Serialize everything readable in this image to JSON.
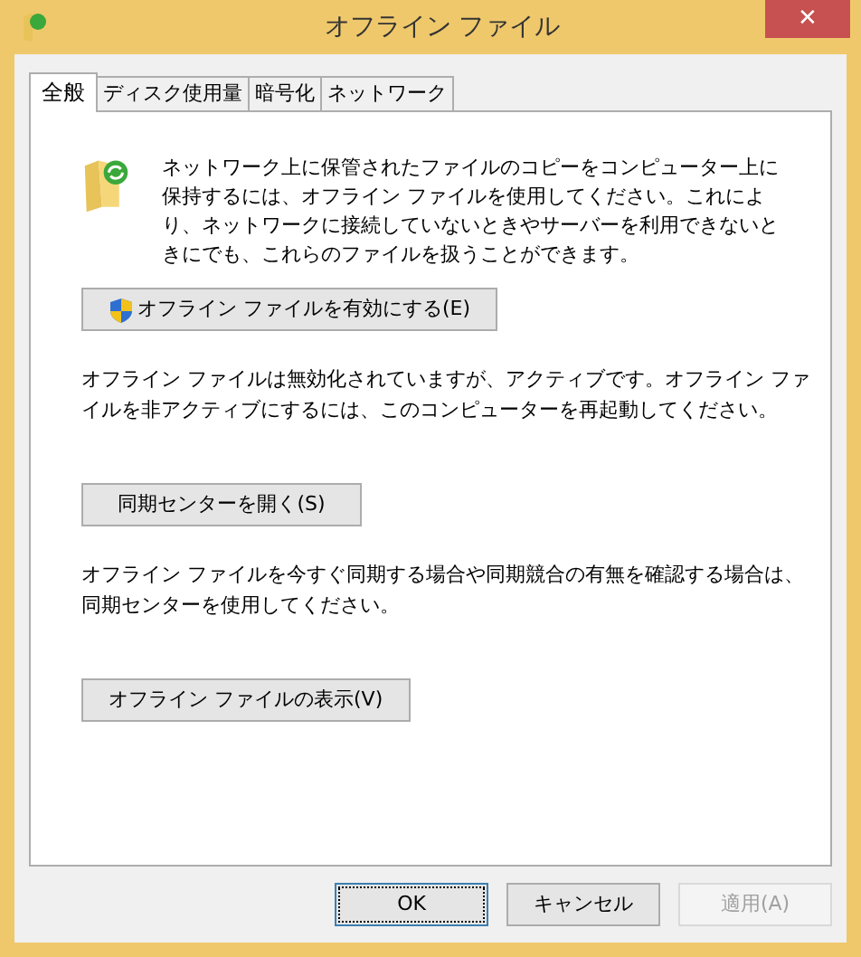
{
  "window": {
    "title": "オフライン ファイル",
    "close": "✕"
  },
  "tabs": [
    {
      "label": "全般",
      "selected": true
    },
    {
      "label": "ディスク使用量",
      "selected": false
    },
    {
      "label": "暗号化",
      "selected": false
    },
    {
      "label": "ネットワーク",
      "selected": false
    }
  ],
  "intro": "ネットワーク上に保管されたファイルのコピーをコンピューター上に保持するには、オフライン ファイルを使用してください。これにより、ネットワークに接続していないときやサーバーを利用できないときにでも、これらのファイルを扱うことができます。",
  "sections": [
    {
      "button": "オフライン ファイルを有効にする(E)",
      "shield": true,
      "text": "オフライン ファイルは無効化されていますが、アクティブです。オフライン ファイルを非アクティブにするには、このコンピューターを再起動してください。"
    },
    {
      "button": "同期センターを開く(S)",
      "shield": false,
      "text": "オフライン ファイルを今すぐ同期する場合や同期競合の有無を確認する場合は、同期センターを使用してください。"
    },
    {
      "button": "オフライン ファイルの表示(V)",
      "shield": false
    }
  ],
  "buttons": [
    {
      "label": "OK",
      "default": true,
      "disabled": false
    },
    {
      "label": "キャンセル",
      "default": false,
      "disabled": false
    },
    {
      "label": "適用(A)",
      "default": false,
      "disabled": true
    }
  ]
}
